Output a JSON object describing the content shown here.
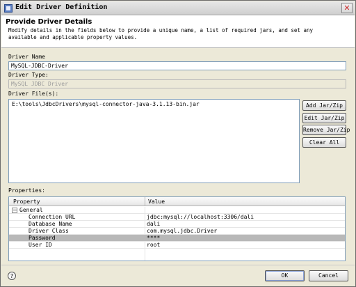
{
  "window": {
    "title": "Edit Driver Definition"
  },
  "header": {
    "title": "Provide Driver Details",
    "description": "Modify details in the fields below to provide a unique name, a list of required jars, and set any available and applicable property values."
  },
  "form": {
    "driver_name_label": "Driver Name",
    "driver_name_value": "MySQL-JDBC-Driver",
    "driver_type_label": "Driver Type:",
    "driver_type_value": "MySQL JDBC Driver",
    "driver_files_label": "Driver File(s):",
    "driver_files": [
      "E:\\tools\\JdbcDrivers\\mysql-connector-java-3.1.13-bin.jar"
    ],
    "buttons": {
      "add": "Add Jar/Zip",
      "edit": "Edit Jar/Zip",
      "remove": "Remove Jar/Zip",
      "clear": "Clear All"
    }
  },
  "properties": {
    "label": "Properties:",
    "columns": [
      "Property",
      "Value"
    ],
    "group": "General",
    "rows": [
      {
        "property": "Connection URL",
        "value": "jdbc:mysql://localhost:3306/dali"
      },
      {
        "property": "Database Name",
        "value": "dali"
      },
      {
        "property": "Driver Class",
        "value": "com.mysql.jdbc.Driver"
      },
      {
        "property": "Password",
        "value": "****"
      },
      {
        "property": "User ID",
        "value": "root"
      }
    ],
    "selected_row": 3
  },
  "footer": {
    "ok": "OK",
    "cancel": "Cancel",
    "help_symbol": "?"
  }
}
